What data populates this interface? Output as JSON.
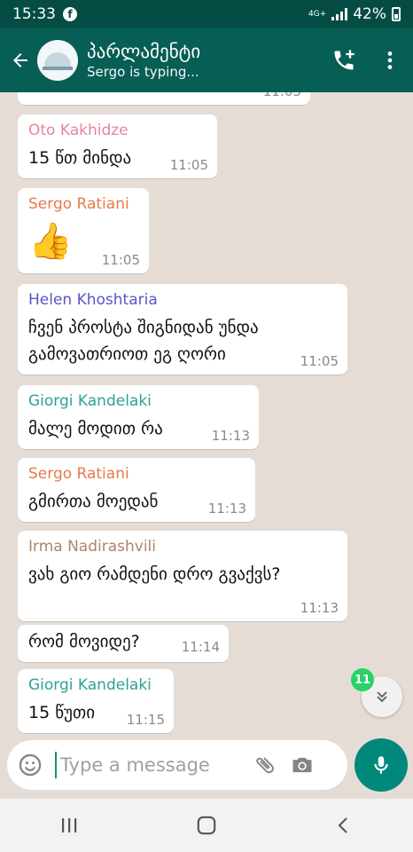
{
  "status": {
    "time": "15:33",
    "fb_glyph": "f",
    "network": "4G+",
    "battery": "42%"
  },
  "header": {
    "title": "პარლამენტი",
    "subtitle": "Sergo is typing..."
  },
  "messages": [
    {
      "sender": "",
      "text": "",
      "time": "11:05"
    },
    {
      "sender": "Oto Kakhidze",
      "color": "#e7849d",
      "text": "15 წთ მინდა",
      "time": "11:05"
    },
    {
      "sender": "Sergo Ratiani",
      "color": "#e8794a",
      "text": "👍",
      "time": "11:05"
    },
    {
      "sender": "Helen Khoshtaria",
      "color": "#5a55c9",
      "text": "ჩვენ პროსტა შიგნიდან უნდა გამოვათრიოთ ეგ ღორი",
      "time": "11:05"
    },
    {
      "sender": "Giorgi Kandelaki",
      "color": "#2fa294",
      "text": "მალე მოდით რა",
      "time": "11:13"
    },
    {
      "sender": "Sergo Ratiani",
      "color": "#e8794a",
      "text": "გმირთა მოედან",
      "time": "11:13"
    },
    {
      "sender": "Irma Nadirashvili",
      "color": "#b0836b",
      "text": "ვახ გიო რამდენი დრო გვაქვს?",
      "time": "11:13"
    },
    {
      "sender": "",
      "text": "რომ მოვიდე?",
      "time": "11:14"
    },
    {
      "sender": "Giorgi Kandelaki",
      "color": "#2fa294",
      "text": "15 წუთი",
      "time": "11:15"
    }
  ],
  "scroll": {
    "unread_count": "11"
  },
  "composer": {
    "placeholder": "Type a message"
  },
  "colors": {
    "header": "#075e54",
    "statusbar": "#054d44",
    "accent": "#00897b",
    "unread_badge": "#25d366",
    "chat_bg": "#e5ddd5"
  },
  "icons": [
    "back-arrow-icon",
    "add-call-icon",
    "more-vert-icon",
    "emoji-icon",
    "attach-icon",
    "camera-icon",
    "mic-icon",
    "chevron-double-down-icon",
    "recents-icon",
    "home-icon",
    "back-icon"
  ]
}
